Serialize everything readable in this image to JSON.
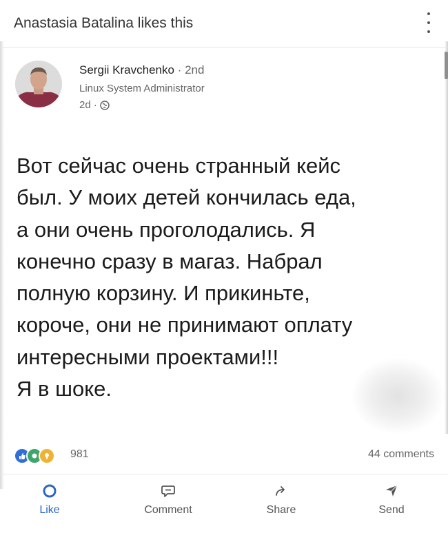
{
  "activity": {
    "text": "Anastasia Batalina likes this"
  },
  "author": {
    "name": "Sergii Kravchenko",
    "degree": "· 2nd",
    "title": "Linux System Administrator",
    "time": "2d ·"
  },
  "post": {
    "lines": [
      "Вот сейчас очень странный кейс",
      "был. У моих детей кончилась еда,",
      "а они очень проголодались. Я",
      "конечно сразу в магаз. Набрал",
      "полную корзину. И прикиньте,",
      "короче, они не принимают оплату",
      "интересными проектами!!!",
      "Я в шоке."
    ]
  },
  "stats": {
    "reactions_count": "981",
    "comments": "44 comments"
  },
  "actions": {
    "like": "Like",
    "comment": "Comment",
    "share": "Share",
    "send": "Send"
  },
  "colors": {
    "like_blue": "#2b66c4",
    "celebrate_green": "#3fa66b",
    "insight_yellow": "#f0b232",
    "muted_text": "#666666"
  },
  "icons": {
    "menu": "more-vertical-icon",
    "visibility": "globe-icon",
    "like": "thumbs-up-icon",
    "comment": "speech-bubble-icon",
    "share": "share-arrow-icon",
    "send": "paper-plane-icon"
  }
}
